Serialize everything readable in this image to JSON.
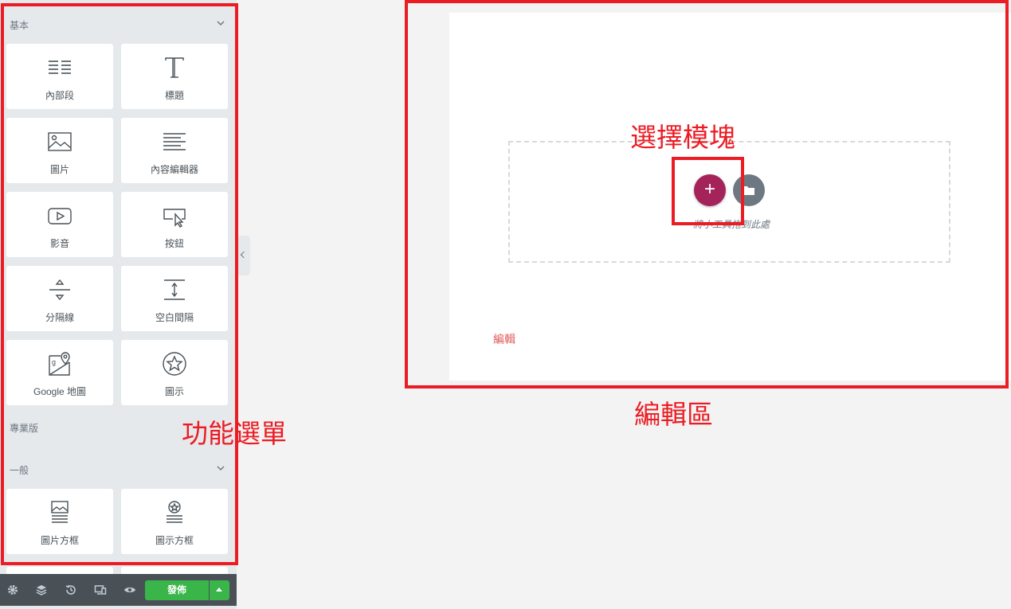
{
  "panel": {
    "categories": {
      "basic": "基本",
      "pro": "專業版",
      "general": "一般"
    },
    "widgets": [
      {
        "label": "內部段",
        "icon": "inner-section-icon"
      },
      {
        "label": "標題",
        "icon": "heading-icon"
      },
      {
        "label": "圖片",
        "icon": "image-icon"
      },
      {
        "label": "內容編輯器",
        "icon": "text-editor-icon"
      },
      {
        "label": "影音",
        "icon": "video-icon"
      },
      {
        "label": "按鈕",
        "icon": "button-icon"
      },
      {
        "label": "分隔線",
        "icon": "divider-icon"
      },
      {
        "label": "空白間隔",
        "icon": "spacer-icon"
      },
      {
        "label": "Google 地圖",
        "icon": "google-maps-icon"
      },
      {
        "label": "圖示",
        "icon": "star-icon"
      }
    ],
    "general_widgets": [
      {
        "label": "圖片方框",
        "icon": "image-box-icon"
      },
      {
        "label": "圖示方框",
        "icon": "icon-box-icon"
      }
    ]
  },
  "footer": {
    "publish_label": "發佈",
    "icons": [
      "settings-icon",
      "navigator-icon",
      "history-icon",
      "responsive-icon",
      "preview-icon"
    ],
    "publish_color": "#39b54a"
  },
  "canvas": {
    "drop_hint": "將小工具拖到此處",
    "edit_link": "編輯",
    "add_section_color": "#a4245a",
    "template_color": "#6d7882"
  },
  "annotations": {
    "menu": "功能選單",
    "editor": "編輯區",
    "select_module": "選擇模塊",
    "color": "#ec1c24"
  }
}
